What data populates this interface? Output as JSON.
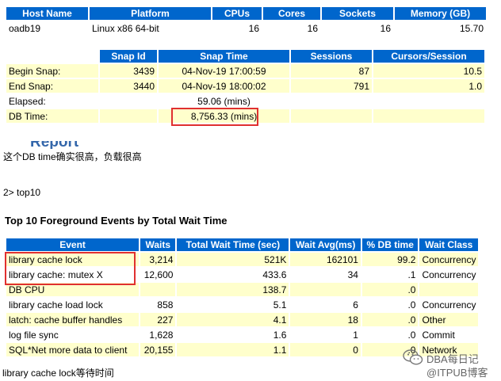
{
  "host_table": {
    "headers": [
      "Host Name",
      "Platform",
      "CPUs",
      "Cores",
      "Sockets",
      "Memory (GB)"
    ],
    "row": [
      "oadb19",
      "Linux x86 64-bit",
      "16",
      "16",
      "16",
      "15.70"
    ]
  },
  "snap_table": {
    "headers": [
      "Snap Id",
      "Snap Time",
      "Sessions",
      "Cursors/Session"
    ],
    "rows": [
      [
        "Begin Snap:",
        "3439",
        "04-Nov-19 17:00:59",
        "87",
        "10.5"
      ],
      [
        "End Snap:",
        "3440",
        "04-Nov-19 18:00:02",
        "791",
        "1.0"
      ],
      [
        "Elapsed:",
        "",
        "59.06 (mins)",
        "",
        ""
      ],
      [
        "DB Time:",
        "",
        "8,756.33 (mins)",
        "",
        ""
      ]
    ]
  },
  "partial_heading": "Report S",
  "note1": "这个DB time确实很高，负载很高",
  "note2": "2> top10",
  "events_section": {
    "title": "Top 10 Foreground Events by Total Wait Time",
    "headers": [
      "Event",
      "Waits",
      "Total Wait Time (sec)",
      "Wait Avg(ms)",
      "% DB time",
      "Wait Class"
    ],
    "rows": [
      [
        "library cache lock",
        "3,214",
        "521K",
        "162101",
        "99.2",
        "Concurrency"
      ],
      [
        "library cache: mutex X",
        "12,600",
        "433.6",
        "34",
        ".1",
        "Concurrency"
      ],
      [
        "DB CPU",
        "",
        "138.7",
        "",
        ".0",
        ""
      ],
      [
        "library cache load lock",
        "858",
        "5.1",
        "6",
        ".0",
        "Concurrency"
      ],
      [
        "latch: cache buffer handles",
        "227",
        "4.1",
        "18",
        ".0",
        "Other"
      ],
      [
        "log file sync",
        "1,628",
        "1.6",
        "1",
        ".0",
        "Commit"
      ],
      [
        "SQL*Net more data to client",
        "20,155",
        "1.1",
        "0",
        ".0",
        "Network"
      ]
    ]
  },
  "note3": "library cache lock等待时间",
  "watermark": {
    "line1": "DBA每日记",
    "line2": "@ITPUB博客",
    "icon": "wechat-icon"
  },
  "colors": {
    "header_bg": "#0066cc",
    "row_alt_bg": "#ffffcc",
    "highlight_box": "#e03030"
  }
}
